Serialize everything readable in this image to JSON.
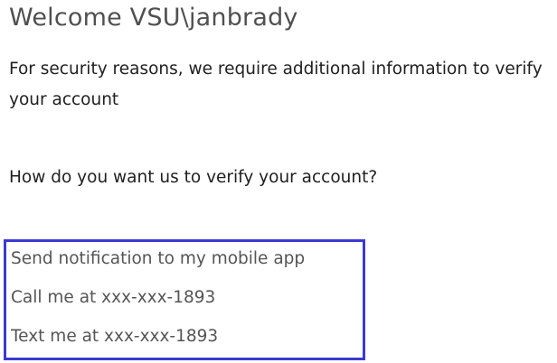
{
  "header": {
    "welcome_text": "Welcome VSU\\janbrady"
  },
  "main": {
    "security_message": "For security reasons, we require additional information to verify your account",
    "verify_question": "How do you want us to verify your account?",
    "options": [
      {
        "label": "Send notification to my mobile app"
      },
      {
        "label": "Call me at xxx-xxx-1893"
      },
      {
        "label": "Text me at xxx-xxx-1893"
      }
    ]
  },
  "colors": {
    "options_border": "#3a3ad0",
    "title_text": "#505050",
    "option_text": "#555555"
  }
}
